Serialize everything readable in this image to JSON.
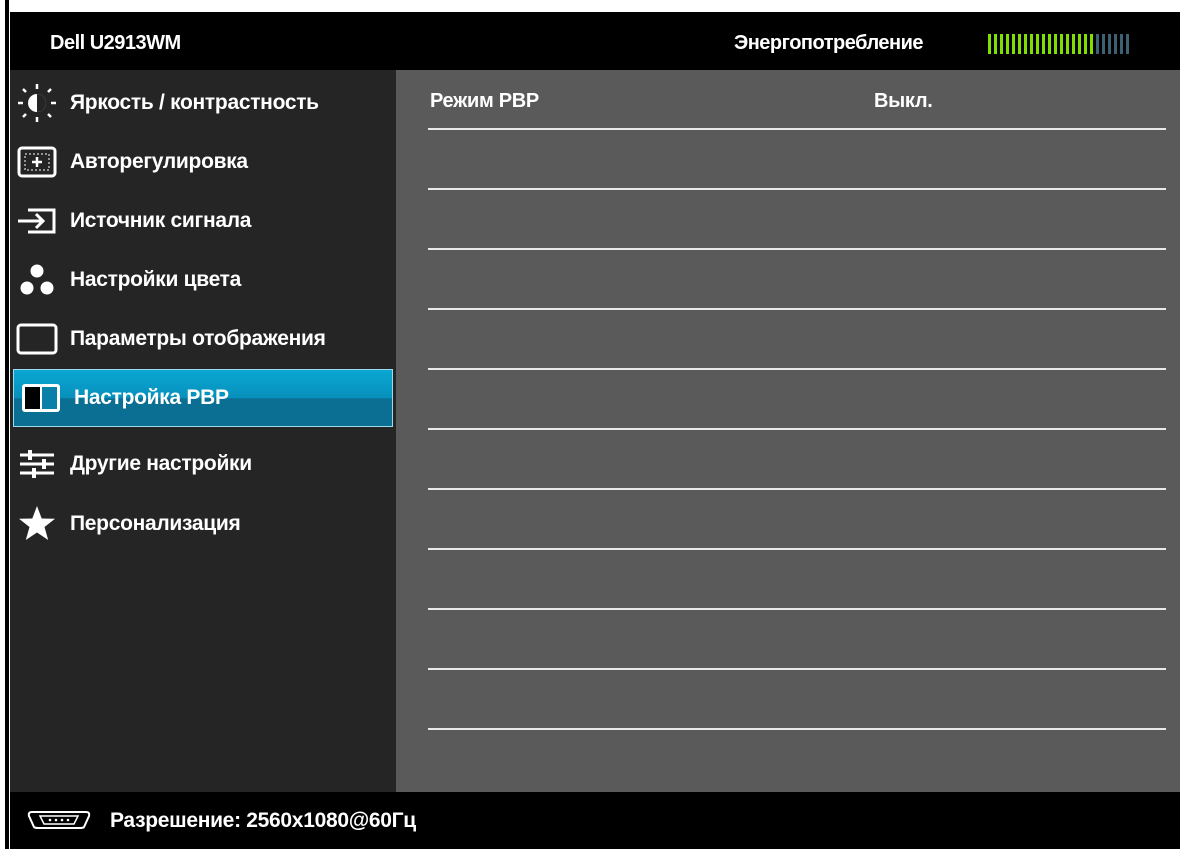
{
  "header": {
    "model": "Dell U2913WM",
    "power_label": "Энергопотребление",
    "power_level": 0.75
  },
  "sidebar": {
    "items": [
      {
        "label": "Яркость / контрастность",
        "icon": "brightness-icon"
      },
      {
        "label": "Авторегулировка",
        "icon": "auto-adjust-icon"
      },
      {
        "label": "Источник сигнала",
        "icon": "input-source-icon"
      },
      {
        "label": "Настройки цвета",
        "icon": "color-dots-icon"
      },
      {
        "label": "Параметры отображения",
        "icon": "display-rect-icon"
      },
      {
        "label": "Настройка PBP",
        "icon": "pbp-icon",
        "selected": true
      },
      {
        "label": "Другие настройки",
        "icon": "sliders-icon"
      },
      {
        "label": "Персонализация",
        "icon": "star-icon"
      }
    ]
  },
  "content": {
    "rows": [
      {
        "key": "Режим PBP",
        "value": "Выкл."
      }
    ]
  },
  "footer": {
    "resolution": "Разрешение: 2560x1080@60Гц",
    "icon": "vga-connector-icon"
  },
  "colors": {
    "selected_bg": "#0a9ccd",
    "power_on": "#7fe000",
    "power_off": "#3f5f73",
    "content_bg": "#5a5a5a",
    "sidebar_bg": "#252525"
  }
}
